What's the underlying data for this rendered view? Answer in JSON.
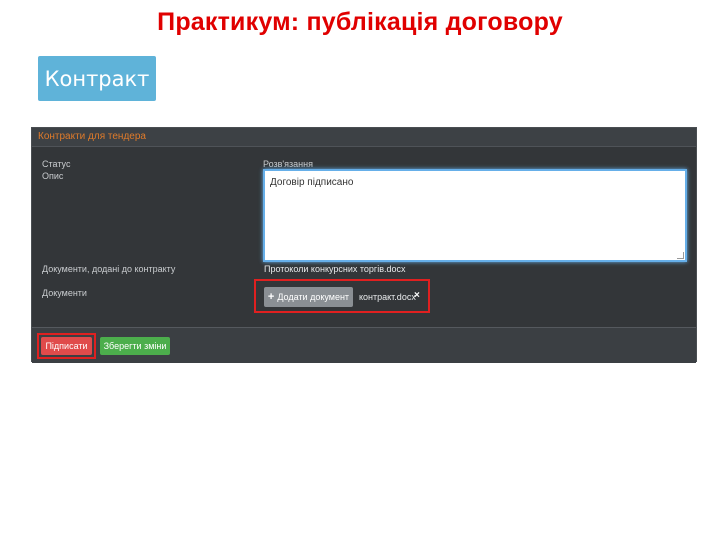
{
  "slide": {
    "title": "Практикум: публікація договору",
    "contract_button": "Контракт"
  },
  "panel": {
    "title": "Контракти для тендера",
    "labels": {
      "status": "Статус",
      "description": "Опис",
      "documents_added": "Документи, додані до контракту",
      "documents": "Документи"
    },
    "resolution": {
      "label": "Розв'язання",
      "value": "Договір підписано"
    },
    "existing_document": "Протоколи конкурсних торгів.docx",
    "add_document_button": "Додати документ",
    "add_icon": "+",
    "uploaded_file": "контракт.docx",
    "remove_icon": "×"
  },
  "footer": {
    "sign_button": "Підписати",
    "save_button": "Зберегти зміни"
  },
  "colors": {
    "title_red": "#e00000",
    "contract_blue": "#5fb3d9",
    "panel_dark": "#333639",
    "header_orange": "#e07b2a",
    "highlight_red": "#e02020",
    "sign_red": "#e04b4b",
    "save_green": "#4cae4c"
  }
}
